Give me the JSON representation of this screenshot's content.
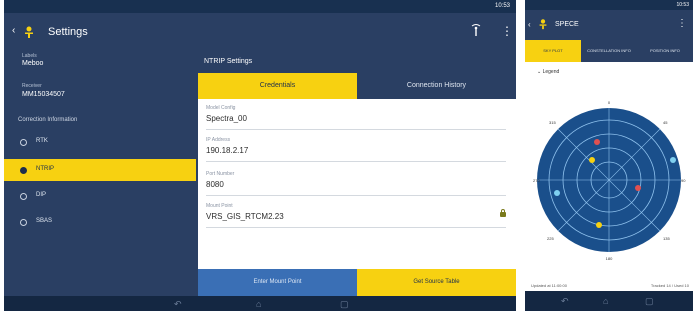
{
  "tablet": {
    "status_time": "10:53",
    "title": "Settings",
    "info": {
      "labels_label": "Labels",
      "labels_value": "Meboo",
      "receiver_label": "Receiver",
      "receiver_value": "MM15034507",
      "section": "Correction Information"
    },
    "radio_options": [
      {
        "label": "RTK",
        "selected": false
      },
      {
        "label": "NTRIP",
        "selected": true
      },
      {
        "label": "DIP",
        "selected": false
      },
      {
        "label": "SBAS",
        "selected": false
      }
    ],
    "panel_title": "NTRIP Settings",
    "tabs": [
      {
        "label": "Credentials",
        "active": true
      },
      {
        "label": "Connection History",
        "active": false
      }
    ],
    "fields": [
      {
        "label": "Model Config",
        "value": "Spectra_00"
      },
      {
        "label": "IP Address",
        "value": "190.18.2.17"
      },
      {
        "label": "Port Number",
        "value": "8080"
      },
      {
        "label": "Mount Point",
        "value": "VRS_GIS_RTCM2.23"
      }
    ],
    "buttons": {
      "enter_mount": "Enter Mount Point",
      "get_source": "Get Source Table"
    }
  },
  "phone": {
    "status_time": "10:53",
    "title": "SPECE",
    "tabs": [
      "SKY PLOT",
      "CONSTELLATION INFO",
      "POSITION INFO"
    ],
    "legend": "Legend",
    "directions": {
      "n": "0",
      "e": "90",
      "s": "180",
      "w": "270",
      "ne": "45",
      "nw": "315",
      "se": "135",
      "sw": "225"
    },
    "footer_left": "Updated at 11:00:00",
    "footer_right": "Tracked 14 / Used 10"
  },
  "colors": {
    "navy": "#2a3f63",
    "yellow": "#f7d111",
    "blue_button": "#3a6fb5",
    "sky_outer": "#1a4f8b",
    "sky_ring": "#2f7bc2"
  },
  "icons": {
    "back": "arrow-left-icon",
    "app_logo": "person-receiver-icon",
    "antenna": "antenna-icon",
    "menu": "more-vert-icon",
    "lock": "lock-icon"
  }
}
